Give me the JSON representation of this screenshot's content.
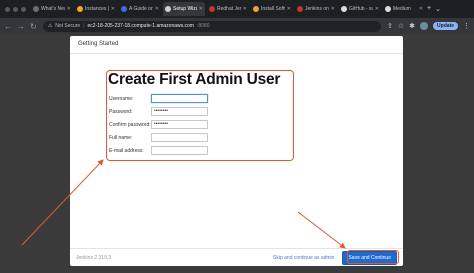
{
  "browser": {
    "tabs": [
      {
        "label": "What's New",
        "favicon_color": "#6e6e6e",
        "active": false
      },
      {
        "label": "Instances | E",
        "favicon_color": "#f5a623",
        "active": false
      },
      {
        "label": "A Guide on",
        "favicon_color": "#3a6fd8",
        "active": false
      },
      {
        "label": "Setup Wizar",
        "favicon_color": "#d0d0d0",
        "active": true
      },
      {
        "label": "Redhat Jenk",
        "favicon_color": "#c0392b",
        "active": false
      },
      {
        "label": "Install Softw",
        "favicon_color": "#e8a33d",
        "active": false
      },
      {
        "label": "Jenkins on",
        "favicon_color": "#c0392b",
        "active": false
      },
      {
        "label": "GitHub - sun",
        "favicon_color": "#dcdcdc",
        "active": false
      },
      {
        "label": "Medium",
        "favicon_color": "#dcdcdc",
        "active": false
      }
    ],
    "address": {
      "security": "Not Secure",
      "host": "ec2-18-205-237-18.compute-1.amazonaws.com",
      "port": ":8080"
    },
    "update_label": "Update"
  },
  "dialog": {
    "header": "Getting Started",
    "form_title": "Create First Admin User",
    "fields": [
      {
        "label": "Username:",
        "value": "",
        "focused": true
      },
      {
        "label": "Password:",
        "value": "••••••••",
        "focused": false
      },
      {
        "label": "Confirm password:",
        "value": "••••••••",
        "focused": false
      },
      {
        "label": "Full name:",
        "value": "",
        "focused": false
      },
      {
        "label": "E-mail address:",
        "value": "",
        "focused": false
      }
    ],
    "footer": {
      "version": "Jenkins 2.319.3",
      "skip_label": "Skip and continue as admin",
      "save_label": "Save and Continue"
    }
  },
  "annotation_color": "#e0592d"
}
